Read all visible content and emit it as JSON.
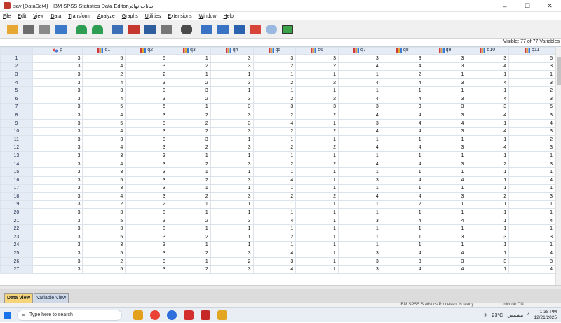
{
  "window": {
    "title": "sav [DataSet4] - IBM SPSS Statistics Data Editorبيانات نهائي",
    "controls": [
      "–",
      "☐",
      "✕"
    ]
  },
  "menu": [
    "File",
    "Edit",
    "View",
    "Data",
    "Transform",
    "Analyze",
    "Graphs",
    "Utilities",
    "Extensions",
    "Window",
    "Help"
  ],
  "toolbar_icons": [
    "open-folder-icon",
    "save-icon",
    "print-icon",
    "dialog-recall-icon",
    "undo-icon",
    "redo-icon",
    "goto-case-icon",
    "goto-variable-icon",
    "variables-icon",
    "run-descriptives-icon",
    "find-icon",
    "insert-cases-icon",
    "insert-variable-icon",
    "split-file-icon",
    "weight-cases-icon",
    "select-cases-icon",
    "value-labels-icon",
    "use-sets-icon",
    "spell-check-icon"
  ],
  "visible_label": "Visible: 77 of 77 Variables",
  "columns": [
    {
      "name": "p",
      "measure": "nominal"
    },
    {
      "name": "q1",
      "measure": "ordinal"
    },
    {
      "name": "q2",
      "measure": "ordinal"
    },
    {
      "name": "q3",
      "measure": "ordinal"
    },
    {
      "name": "q4",
      "measure": "ordinal"
    },
    {
      "name": "q5",
      "measure": "ordinal"
    },
    {
      "name": "q6",
      "measure": "ordinal"
    },
    {
      "name": "q7",
      "measure": "ordinal"
    },
    {
      "name": "q8",
      "measure": "ordinal"
    },
    {
      "name": "q9",
      "measure": "ordinal"
    },
    {
      "name": "q10",
      "measure": "ordinal"
    },
    {
      "name": "q11",
      "measure": "ordinal"
    }
  ],
  "rows": [
    {
      "n": "1",
      "v": [
        "3",
        "5",
        "5",
        "1",
        "3",
        "3",
        "3",
        "3",
        "3",
        "3",
        "3",
        "5"
      ]
    },
    {
      "n": "2",
      "v": [
        "3",
        "4",
        "3",
        "2",
        "3",
        "2",
        "2",
        "4",
        "4",
        "3",
        "4",
        "3"
      ]
    },
    {
      "n": "3",
      "v": [
        "3",
        "2",
        "2",
        "1",
        "1",
        "1",
        "1",
        "1",
        "2",
        "1",
        "1",
        "1"
      ]
    },
    {
      "n": "4",
      "v": [
        "3",
        "4",
        "3",
        "2",
        "3",
        "2",
        "2",
        "4",
        "4",
        "3",
        "4",
        "3"
      ]
    },
    {
      "n": "5",
      "v": [
        "3",
        "3",
        "3",
        "3",
        "1",
        "1",
        "1",
        "1",
        "1",
        "1",
        "1",
        "2"
      ]
    },
    {
      "n": "6",
      "v": [
        "3",
        "4",
        "3",
        "2",
        "3",
        "2",
        "2",
        "4",
        "4",
        "3",
        "4",
        "3"
      ]
    },
    {
      "n": "7",
      "v": [
        "3",
        "5",
        "5",
        "1",
        "3",
        "3",
        "3",
        "3",
        "3",
        "3",
        "3",
        "5"
      ]
    },
    {
      "n": "8",
      "v": [
        "3",
        "4",
        "3",
        "2",
        "3",
        "2",
        "2",
        "4",
        "4",
        "3",
        "4",
        "3"
      ]
    },
    {
      "n": "9",
      "v": [
        "3",
        "5",
        "3",
        "2",
        "3",
        "4",
        "1",
        "3",
        "4",
        "4",
        "1",
        "4"
      ]
    },
    {
      "n": "10",
      "v": [
        "3",
        "4",
        "3",
        "2",
        "3",
        "2",
        "2",
        "4",
        "4",
        "3",
        "4",
        "3"
      ]
    },
    {
      "n": "11",
      "v": [
        "3",
        "3",
        "3",
        "3",
        "1",
        "1",
        "1",
        "1",
        "1",
        "1",
        "1",
        "2"
      ]
    },
    {
      "n": "12",
      "v": [
        "3",
        "4",
        "3",
        "2",
        "3",
        "2",
        "2",
        "4",
        "4",
        "3",
        "4",
        "3"
      ]
    },
    {
      "n": "13",
      "v": [
        "3",
        "3",
        "3",
        "1",
        "1",
        "1",
        "1",
        "1",
        "1",
        "1",
        "1",
        "1"
      ]
    },
    {
      "n": "14",
      "v": [
        "3",
        "4",
        "3",
        "2",
        "3",
        "2",
        "2",
        "4",
        "4",
        "3",
        "2",
        "3"
      ]
    },
    {
      "n": "15",
      "v": [
        "3",
        "3",
        "3",
        "1",
        "1",
        "1",
        "1",
        "1",
        "1",
        "1",
        "1",
        "1"
      ]
    },
    {
      "n": "16",
      "v": [
        "3",
        "5",
        "3",
        "2",
        "3",
        "4",
        "1",
        "3",
        "4",
        "4",
        "1",
        "4"
      ]
    },
    {
      "n": "17",
      "v": [
        "3",
        "3",
        "3",
        "1",
        "1",
        "1",
        "1",
        "1",
        "1",
        "1",
        "1",
        "1"
      ]
    },
    {
      "n": "18",
      "v": [
        "3",
        "4",
        "3",
        "2",
        "3",
        "2",
        "2",
        "4",
        "4",
        "3",
        "2",
        "3"
      ]
    },
    {
      "n": "19",
      "v": [
        "3",
        "2",
        "2",
        "1",
        "1",
        "1",
        "1",
        "1",
        "2",
        "1",
        "1",
        "1"
      ]
    },
    {
      "n": "20",
      "v": [
        "3",
        "3",
        "3",
        "1",
        "1",
        "1",
        "1",
        "1",
        "1",
        "1",
        "1",
        "1"
      ]
    },
    {
      "n": "21",
      "v": [
        "3",
        "5",
        "3",
        "2",
        "3",
        "4",
        "1",
        "3",
        "4",
        "4",
        "1",
        "4"
      ]
    },
    {
      "n": "22",
      "v": [
        "3",
        "3",
        "3",
        "1",
        "1",
        "1",
        "1",
        "1",
        "1",
        "1",
        "1",
        "1"
      ]
    },
    {
      "n": "23",
      "v": [
        "3",
        "5",
        "3",
        "2",
        "1",
        "2",
        "1",
        "1",
        "1",
        "3",
        "3",
        "3"
      ]
    },
    {
      "n": "24",
      "v": [
        "3",
        "3",
        "3",
        "1",
        "1",
        "1",
        "1",
        "1",
        "1",
        "1",
        "1",
        "1"
      ]
    },
    {
      "n": "25",
      "v": [
        "3",
        "5",
        "3",
        "2",
        "3",
        "4",
        "1",
        "3",
        "4",
        "4",
        "1",
        "4"
      ]
    },
    {
      "n": "26",
      "v": [
        "3",
        "2",
        "3",
        "1",
        "2",
        "3",
        "1",
        "3",
        "3",
        "3",
        "3",
        "3"
      ]
    },
    {
      "n": "27",
      "v": [
        "3",
        "5",
        "3",
        "2",
        "3",
        "4",
        "1",
        "3",
        "4",
        "4",
        "1",
        "4"
      ]
    }
  ],
  "tabs": [
    {
      "label": "Data View",
      "active": true
    },
    {
      "label": "Variable View",
      "active": false
    }
  ],
  "status": {
    "processor": "IBM SPSS Statistics Processor is ready",
    "unicode": "Unicode:ON"
  },
  "taskbar": {
    "search_placeholder": "Type here to search",
    "weather": "23°C",
    "weather_label": "مشمس",
    "time": "1:38 PM",
    "date": "12/21/2025",
    "app_colors": [
      "#2f6fdb",
      "#e3a11b",
      "#ea4335",
      "#d32f2f",
      "#c62828",
      "#e2a622"
    ]
  }
}
